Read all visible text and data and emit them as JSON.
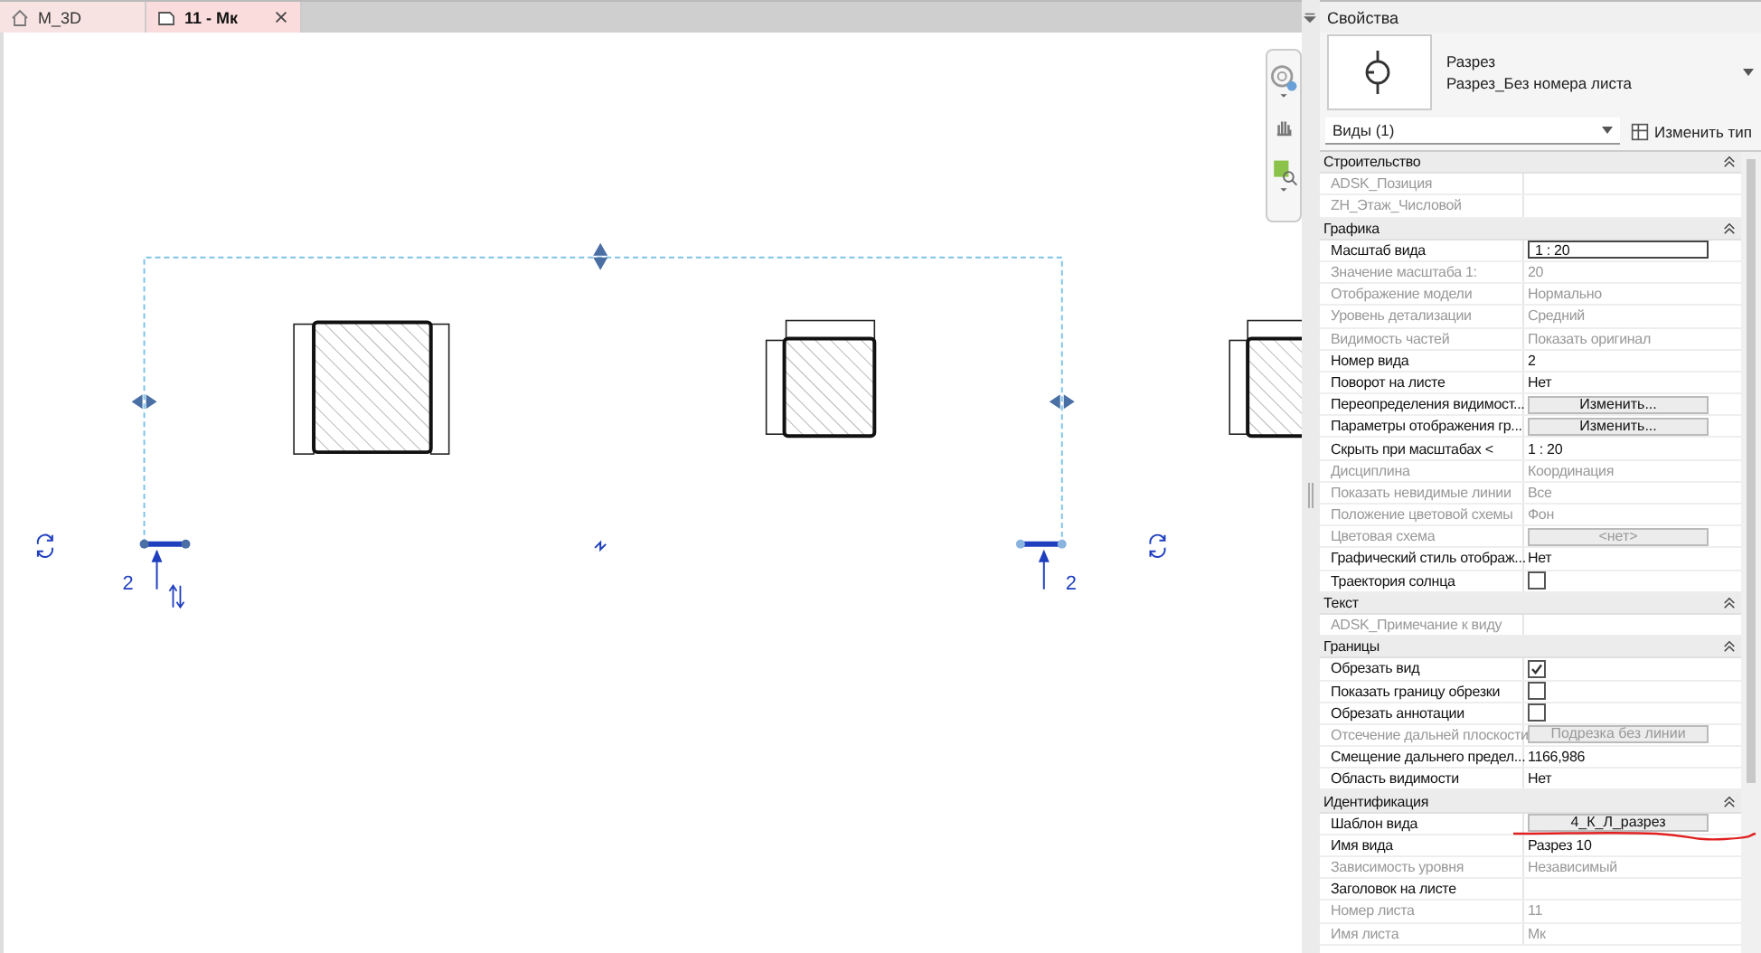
{
  "tabs": [
    {
      "label": "M_3D",
      "selected": false
    },
    {
      "label": "11 - Мк",
      "selected": true
    }
  ],
  "canvas": {
    "section_labels": [
      "2",
      "2"
    ]
  },
  "properties": {
    "title": "Свойства",
    "type_name": "Разрез",
    "type_subname": "Разрез_Без номера листа",
    "filter": "Виды (1)",
    "edit_type": "Изменить тип",
    "groups": [
      {
        "title": "Строительство",
        "rows": [
          {
            "label": "ADSK_Позиция",
            "kind": "text",
            "disabled": true
          },
          {
            "label": "ZH_Этаж_Числовой",
            "kind": "text",
            "disabled": true
          }
        ]
      },
      {
        "title": "Графика",
        "rows": [
          {
            "label": "Масштаб вида",
            "kind": "input",
            "value": "1 : 20",
            "disabled": false
          },
          {
            "label": "Значение масштаба    1:",
            "kind": "text",
            "value": "20",
            "disabled": true
          },
          {
            "label": "Отображение модели",
            "kind": "text",
            "value": "Нормально",
            "disabled": true
          },
          {
            "label": "Уровень детализации",
            "kind": "text",
            "value": "Средний",
            "disabled": true
          },
          {
            "label": "Видимость частей",
            "kind": "text",
            "value": "Показать оригинал",
            "disabled": true
          },
          {
            "label": "Номер вида",
            "kind": "text",
            "value": "2",
            "disabled": false
          },
          {
            "label": "Поворот на листе",
            "kind": "text",
            "value": "Нет",
            "disabled": false
          },
          {
            "label": "Переопределения видимост...",
            "kind": "button",
            "value": "Изменить...",
            "disabled": false
          },
          {
            "label": "Параметры отображения гр...",
            "kind": "button",
            "value": "Изменить...",
            "disabled": false
          },
          {
            "label": "Скрыть при масштабах <",
            "kind": "text",
            "value": "1 : 20",
            "disabled": false
          },
          {
            "label": "Дисциплина",
            "kind": "text",
            "value": "Координация",
            "disabled": true
          },
          {
            "label": "Показать невидимые линии",
            "kind": "text",
            "value": "Все",
            "disabled": true
          },
          {
            "label": "Положение цветовой схемы",
            "kind": "text",
            "value": "Фон",
            "disabled": true
          },
          {
            "label": "Цветовая схема",
            "kind": "button",
            "value": "<нет>",
            "disabled": true
          },
          {
            "label": "Графический стиль отображ...",
            "kind": "text",
            "value": "Нет",
            "disabled": false
          },
          {
            "label": "Траектория солнца",
            "kind": "checkbox",
            "checked": false,
            "disabled": false
          }
        ]
      },
      {
        "title": "Текст",
        "rows": [
          {
            "label": "ADSK_Примечание к виду",
            "kind": "text",
            "disabled": true
          }
        ]
      },
      {
        "title": "Границы",
        "rows": [
          {
            "label": "Обрезать вид",
            "kind": "checkbox",
            "checked": true,
            "disabled": false
          },
          {
            "label": "Показать границу обрезки",
            "kind": "checkbox",
            "checked": false,
            "disabled": false
          },
          {
            "label": "Обрезать аннотации",
            "kind": "checkbox",
            "checked": false,
            "disabled": false
          },
          {
            "label": "Отсечение дальней плоскости",
            "kind": "button",
            "value": "Подрезка без линии",
            "disabled": true
          },
          {
            "label": "Смещение дальнего предел...",
            "kind": "text",
            "value": "1166,986",
            "disabled": false
          },
          {
            "label": "Область видимости",
            "kind": "text",
            "value": "Нет",
            "disabled": false
          }
        ]
      },
      {
        "title": "Идентификация",
        "rows": [
          {
            "label": "Шаблон вида",
            "kind": "button",
            "value": "4_К_Л_разрез",
            "disabled": false
          },
          {
            "label": "Имя вида",
            "kind": "text",
            "value": "Разрез 10",
            "disabled": false
          },
          {
            "label": "Зависимость уровня",
            "kind": "text",
            "value": "Независимый",
            "disabled": true
          },
          {
            "label": "Заголовок на листе",
            "kind": "text",
            "disabled": false
          },
          {
            "label": "Номер листа",
            "kind": "text",
            "value": "11",
            "disabled": true
          },
          {
            "label": "Имя листа",
            "kind": "text",
            "value": "Мк",
            "disabled": true
          }
        ]
      }
    ]
  }
}
